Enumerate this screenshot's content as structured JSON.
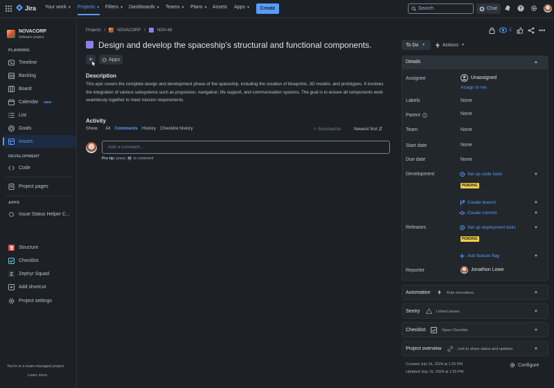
{
  "topbar": {
    "app_name": "Jira",
    "nav": [
      {
        "label": "Your work",
        "has_menu": true
      },
      {
        "label": "Projects",
        "has_menu": true,
        "active": true
      },
      {
        "label": "Filters",
        "has_menu": true
      },
      {
        "label": "Dashboards",
        "has_menu": true
      },
      {
        "label": "Teams",
        "has_menu": true
      },
      {
        "label": "Plans",
        "has_menu": true
      },
      {
        "label": "Assets",
        "has_menu": false
      },
      {
        "label": "Apps",
        "has_menu": true
      }
    ],
    "create_label": "Create",
    "search_placeholder": "Search",
    "chat_label": "Chat",
    "icons": [
      "notifications-icon",
      "help-icon",
      "settings-icon",
      "profile-avatar"
    ]
  },
  "sidebar": {
    "project_name": "NOVACORP",
    "project_type": "Software project",
    "planning_heading": "PLANNING",
    "planning_items": [
      {
        "label": "Timeline",
        "icon": "timeline-icon"
      },
      {
        "label": "Backlog",
        "icon": "backlog-icon"
      },
      {
        "label": "Board",
        "icon": "board-icon"
      },
      {
        "label": "Calendar",
        "icon": "calendar-icon",
        "badge": "NEW"
      },
      {
        "label": "List",
        "icon": "list-icon"
      },
      {
        "label": "Goals",
        "icon": "goals-icon"
      },
      {
        "label": "Issues",
        "icon": "issues-icon",
        "active": true
      }
    ],
    "development_heading": "DEVELOPMENT",
    "code_label": "Code",
    "project_pages_label": "Project pages",
    "apps_heading": "APPS",
    "app_items": [
      {
        "label": "Issue Status Helper C...",
        "icon": "issue-status-helper-icon"
      },
      {
        "label": "Structure",
        "icon": "structure-icon"
      },
      {
        "label": "Checklist",
        "icon": "checklist-icon"
      },
      {
        "label": "Zephyr Squad",
        "icon": "zephyr-squad-icon"
      },
      {
        "label": "Add shortcut",
        "icon": "add-shortcut-icon"
      },
      {
        "label": "Project settings",
        "icon": "settings-icon"
      }
    ],
    "footer_text": "You're in a team-managed project",
    "learn_more": "Learn more"
  },
  "breadcrumb": {
    "projects": "Projects",
    "project": "NOVACORP",
    "issue_key": "NOV-48"
  },
  "issue": {
    "title": "Design and develop the spaceship's structural and functional components.",
    "apps_label": "Apps",
    "description_heading": "Description",
    "description": "This epic covers the complete design and development phase of the spaceship, including the creation of blueprints, 3D models, and prototypes. It involves the integration of various subsystems such as propulsion, navigation, life support, and communication systems. The goal is to ensure all components work seamlessly together to meet mission requirements."
  },
  "activity": {
    "heading": "Activity",
    "show_label": "Show:",
    "tabs": [
      {
        "label": "All"
      },
      {
        "label": "Comments",
        "active": true
      },
      {
        "label": "History"
      },
      {
        "label": "Checklist history"
      }
    ],
    "summarize_label": "Summarize",
    "sort_label": "Newest first",
    "comment_placeholder": "Add a comment...",
    "protip_prefix": "Pro tip:",
    "protip_mid": "press",
    "protip_key": "M",
    "protip_suffix": "to comment"
  },
  "header_actions": {
    "watch_count": "1"
  },
  "status": {
    "current": "To Do",
    "actions_label": "Actions"
  },
  "details": {
    "heading": "Details",
    "assignee_label": "Assignee",
    "assignee_value": "Unassigned",
    "assign_to_me": "Assign to me",
    "labels_label": "Labels",
    "labels_value": "None",
    "parent_label": "Parent",
    "parent_value": "None",
    "team_label": "Team",
    "team_value": "None",
    "start_date_label": "Start date",
    "start_date_value": "None",
    "due_date_label": "Due date",
    "due_date_value": "None",
    "development_label": "Development",
    "setup_code_tools": "Set up code tools",
    "pending_1": "PENDING",
    "create_branch": "Create branch",
    "create_commit": "Create commit",
    "releases_label": "Releases",
    "setup_deployment_tools": "Set up deployment tools",
    "pending_2": "PENDING",
    "add_feature_flag": "Add feature flag",
    "reporter_label": "Reporter",
    "reporter_value": "Jonathon Lowe"
  },
  "panels": {
    "automation_title": "Automation",
    "automation_note": "Rule executions",
    "sentry_title": "Sentry",
    "sentry_note": "Linked issues",
    "checklist_title": "Checklist",
    "checklist_note": "Open Checklist",
    "overview_title": "Project overview",
    "overview_note": "Link to share status and updates"
  },
  "meta": {
    "created": "Created July 16, 2024 at 1:25 PM",
    "updated": "Updated July 16, 2024 at 1:25 PM",
    "configure_label": "Configure"
  },
  "colors": {
    "background": "#1d2125",
    "accent": "#579dff",
    "pending": "#f5cd47",
    "epic": "#8f7ee7"
  }
}
